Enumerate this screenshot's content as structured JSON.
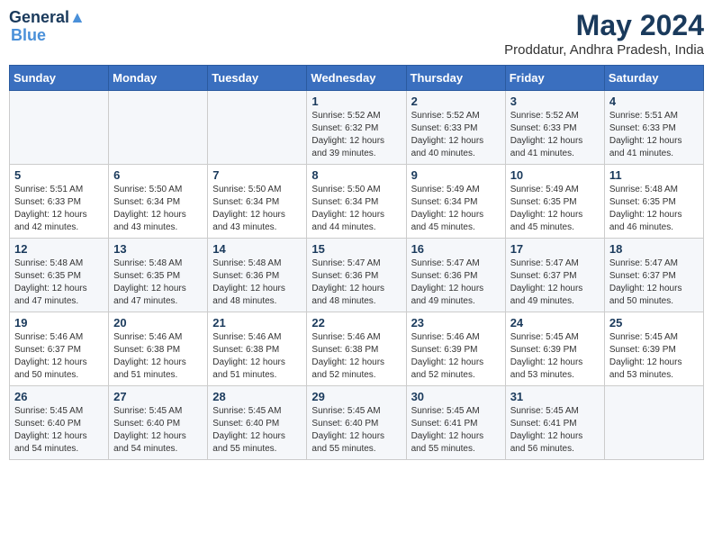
{
  "header": {
    "logo_line1": "General",
    "logo_line2": "Blue",
    "month_year": "May 2024",
    "location": "Proddatur, Andhra Pradesh, India"
  },
  "weekdays": [
    "Sunday",
    "Monday",
    "Tuesday",
    "Wednesday",
    "Thursday",
    "Friday",
    "Saturday"
  ],
  "weeks": [
    [
      {
        "day": "",
        "info": ""
      },
      {
        "day": "",
        "info": ""
      },
      {
        "day": "",
        "info": ""
      },
      {
        "day": "1",
        "info": "Sunrise: 5:52 AM\nSunset: 6:32 PM\nDaylight: 12 hours\nand 39 minutes."
      },
      {
        "day": "2",
        "info": "Sunrise: 5:52 AM\nSunset: 6:33 PM\nDaylight: 12 hours\nand 40 minutes."
      },
      {
        "day": "3",
        "info": "Sunrise: 5:52 AM\nSunset: 6:33 PM\nDaylight: 12 hours\nand 41 minutes."
      },
      {
        "day": "4",
        "info": "Sunrise: 5:51 AM\nSunset: 6:33 PM\nDaylight: 12 hours\nand 41 minutes."
      }
    ],
    [
      {
        "day": "5",
        "info": "Sunrise: 5:51 AM\nSunset: 6:33 PM\nDaylight: 12 hours\nand 42 minutes."
      },
      {
        "day": "6",
        "info": "Sunrise: 5:50 AM\nSunset: 6:34 PM\nDaylight: 12 hours\nand 43 minutes."
      },
      {
        "day": "7",
        "info": "Sunrise: 5:50 AM\nSunset: 6:34 PM\nDaylight: 12 hours\nand 43 minutes."
      },
      {
        "day": "8",
        "info": "Sunrise: 5:50 AM\nSunset: 6:34 PM\nDaylight: 12 hours\nand 44 minutes."
      },
      {
        "day": "9",
        "info": "Sunrise: 5:49 AM\nSunset: 6:34 PM\nDaylight: 12 hours\nand 45 minutes."
      },
      {
        "day": "10",
        "info": "Sunrise: 5:49 AM\nSunset: 6:35 PM\nDaylight: 12 hours\nand 45 minutes."
      },
      {
        "day": "11",
        "info": "Sunrise: 5:48 AM\nSunset: 6:35 PM\nDaylight: 12 hours\nand 46 minutes."
      }
    ],
    [
      {
        "day": "12",
        "info": "Sunrise: 5:48 AM\nSunset: 6:35 PM\nDaylight: 12 hours\nand 47 minutes."
      },
      {
        "day": "13",
        "info": "Sunrise: 5:48 AM\nSunset: 6:35 PM\nDaylight: 12 hours\nand 47 minutes."
      },
      {
        "day": "14",
        "info": "Sunrise: 5:48 AM\nSunset: 6:36 PM\nDaylight: 12 hours\nand 48 minutes."
      },
      {
        "day": "15",
        "info": "Sunrise: 5:47 AM\nSunset: 6:36 PM\nDaylight: 12 hours\nand 48 minutes."
      },
      {
        "day": "16",
        "info": "Sunrise: 5:47 AM\nSunset: 6:36 PM\nDaylight: 12 hours\nand 49 minutes."
      },
      {
        "day": "17",
        "info": "Sunrise: 5:47 AM\nSunset: 6:37 PM\nDaylight: 12 hours\nand 49 minutes."
      },
      {
        "day": "18",
        "info": "Sunrise: 5:47 AM\nSunset: 6:37 PM\nDaylight: 12 hours\nand 50 minutes."
      }
    ],
    [
      {
        "day": "19",
        "info": "Sunrise: 5:46 AM\nSunset: 6:37 PM\nDaylight: 12 hours\nand 50 minutes."
      },
      {
        "day": "20",
        "info": "Sunrise: 5:46 AM\nSunset: 6:38 PM\nDaylight: 12 hours\nand 51 minutes."
      },
      {
        "day": "21",
        "info": "Sunrise: 5:46 AM\nSunset: 6:38 PM\nDaylight: 12 hours\nand 51 minutes."
      },
      {
        "day": "22",
        "info": "Sunrise: 5:46 AM\nSunset: 6:38 PM\nDaylight: 12 hours\nand 52 minutes."
      },
      {
        "day": "23",
        "info": "Sunrise: 5:46 AM\nSunset: 6:39 PM\nDaylight: 12 hours\nand 52 minutes."
      },
      {
        "day": "24",
        "info": "Sunrise: 5:45 AM\nSunset: 6:39 PM\nDaylight: 12 hours\nand 53 minutes."
      },
      {
        "day": "25",
        "info": "Sunrise: 5:45 AM\nSunset: 6:39 PM\nDaylight: 12 hours\nand 53 minutes."
      }
    ],
    [
      {
        "day": "26",
        "info": "Sunrise: 5:45 AM\nSunset: 6:40 PM\nDaylight: 12 hours\nand 54 minutes."
      },
      {
        "day": "27",
        "info": "Sunrise: 5:45 AM\nSunset: 6:40 PM\nDaylight: 12 hours\nand 54 minutes."
      },
      {
        "day": "28",
        "info": "Sunrise: 5:45 AM\nSunset: 6:40 PM\nDaylight: 12 hours\nand 55 minutes."
      },
      {
        "day": "29",
        "info": "Sunrise: 5:45 AM\nSunset: 6:40 PM\nDaylight: 12 hours\nand 55 minutes."
      },
      {
        "day": "30",
        "info": "Sunrise: 5:45 AM\nSunset: 6:41 PM\nDaylight: 12 hours\nand 55 minutes."
      },
      {
        "day": "31",
        "info": "Sunrise: 5:45 AM\nSunset: 6:41 PM\nDaylight: 12 hours\nand 56 minutes."
      },
      {
        "day": "",
        "info": ""
      }
    ]
  ]
}
